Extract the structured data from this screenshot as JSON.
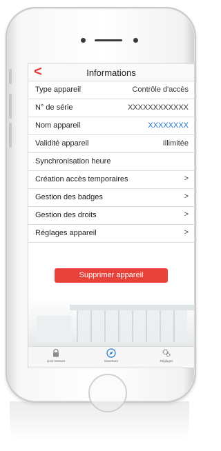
{
  "nav": {
    "title": "Informations",
    "back_icon": "chevron-left-icon"
  },
  "rows": [
    {
      "label": "Type appareil",
      "value": "Contrôle d'accès"
    },
    {
      "label": "N° de série",
      "value": "XXXXXXXXXXXX"
    },
    {
      "label": "Nom appareil",
      "value": "XXXXXXXX"
    },
    {
      "label": "Validité appareil",
      "value": "Illimitée"
    },
    {
      "label": "Synchronisation heure",
      "value": ""
    },
    {
      "label": "Création accès temporaires",
      "value": ">"
    },
    {
      "label": "Gestion des badges",
      "value": ">"
    },
    {
      "label": "Gestion des droits",
      "value": ">"
    },
    {
      "label": "Réglages appareil",
      "value": ">"
    }
  ],
  "delete_button": "Supprimer appareil",
  "tabs": [
    {
      "label": "Liste lecteurs",
      "icon": "lock-icon"
    },
    {
      "label": "Ouverture",
      "icon": "compass-icon"
    },
    {
      "label": "Réglages",
      "icon": "gear-icon"
    }
  ],
  "colors": {
    "accent": "#e8413a",
    "link_blue": "#1a73c8",
    "active_tab": "#2f7fd0"
  }
}
